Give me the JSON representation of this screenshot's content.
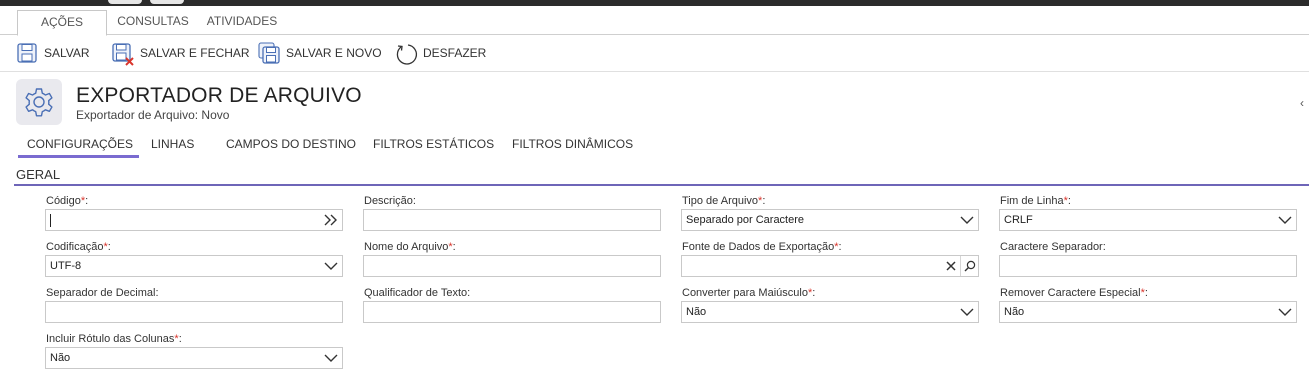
{
  "ribbon": {
    "tabs": [
      {
        "label": "AÇÕES",
        "active": true
      },
      {
        "label": "CONSULTAS",
        "active": false
      },
      {
        "label": "ATIVIDADES",
        "active": false
      }
    ]
  },
  "toolbar": {
    "save_label": "SALVAR",
    "save_close_label": "SALVAR E FECHAR",
    "save_new_label": "SALVAR E NOVO",
    "undo_label": "DESFAZER"
  },
  "header": {
    "icon": "gear-icon",
    "title": "EXPORTADOR DE ARQUIVO",
    "subtitle": "Exportador de Arquivo: Novo"
  },
  "form_tabs": [
    {
      "label": "CONFIGURAÇÕES",
      "active": true
    },
    {
      "label": "LINHAS",
      "active": false
    },
    {
      "label": "CAMPOS DO DESTINO",
      "active": false
    },
    {
      "label": "FILTROS ESTÁTICOS",
      "active": false
    },
    {
      "label": "FILTROS DINÂMICOS",
      "active": false
    }
  ],
  "section": {
    "title": "GERAL"
  },
  "fields": {
    "codigo": {
      "label": "Código",
      "required": "*",
      "value": ""
    },
    "descricao": {
      "label": "Descrição:",
      "value": ""
    },
    "tipo_arquivo": {
      "label": "Tipo de Arquivo",
      "required": "*",
      "value": "Separado por Caractere"
    },
    "fim_linha": {
      "label": "Fim de Linha",
      "required": "*",
      "value": "CRLF"
    },
    "codificacao": {
      "label": "Codificação",
      "required": "*",
      "value": "UTF-8"
    },
    "nome_arquivo": {
      "label": "Nome do Arquivo",
      "required": "*",
      "value": ""
    },
    "fonte_dados": {
      "label": "Fonte de Dados de Exportação",
      "required": "*",
      "value": ""
    },
    "caractere_separador": {
      "label": "Caractere Separador:",
      "value": ""
    },
    "separador_decimal": {
      "label": "Separador de Decimal:",
      "value": ""
    },
    "qualificador_texto": {
      "label": "Qualificador de Texto:",
      "value": ""
    },
    "converter_maiusculo": {
      "label": "Converter para Maiúsculo",
      "required": "*",
      "value": "Não"
    },
    "remover_especial": {
      "label": "Remover Caractere Especial",
      "required": "*",
      "value": "Não"
    },
    "incluir_rotulo": {
      "label": "Incluir Rótulo das Colunas",
      "required": "*",
      "value": "Não"
    }
  },
  "colors": {
    "accent": "#6e65b8",
    "required": "#d9342b",
    "icon_blue": "#4a6fb5"
  }
}
